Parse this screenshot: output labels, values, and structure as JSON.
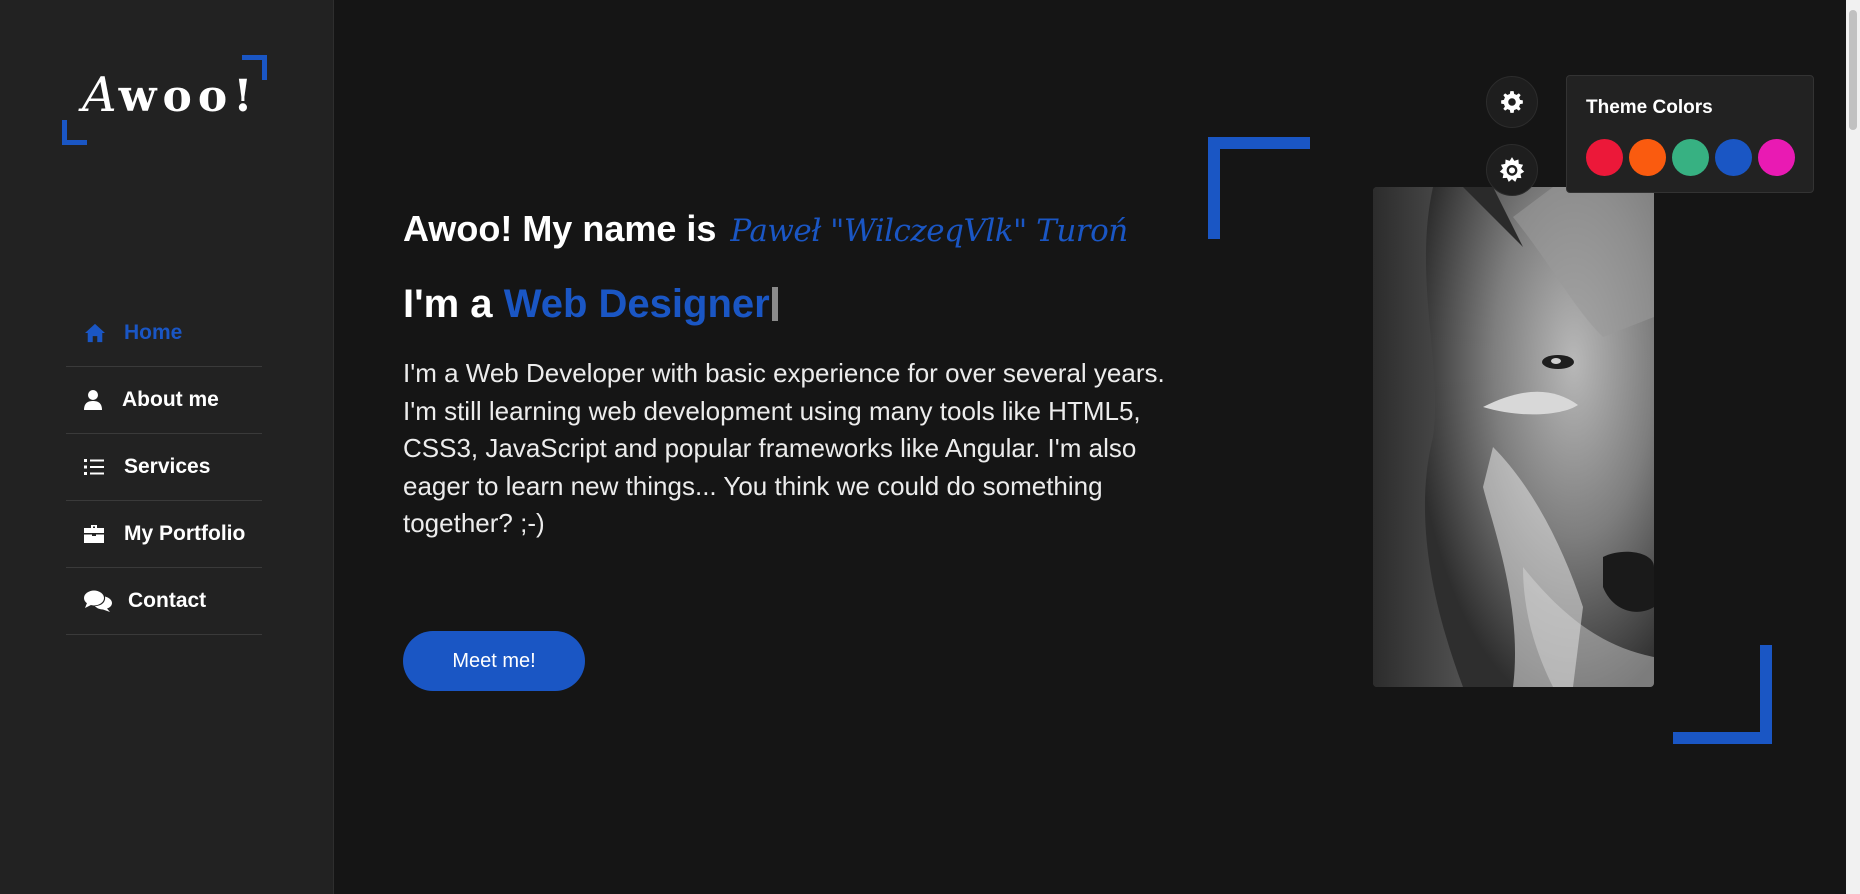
{
  "sidebar": {
    "logo": {
      "first": "A",
      "rest": "woo!"
    },
    "items": [
      {
        "label": "Home",
        "icon": "home-icon",
        "active": true
      },
      {
        "label": "About me",
        "icon": "user-icon",
        "active": false
      },
      {
        "label": "Services",
        "icon": "list-icon",
        "active": false
      },
      {
        "label": "My Portfolio",
        "icon": "briefcase-icon",
        "active": false
      },
      {
        "label": "Contact",
        "icon": "comments-icon",
        "active": false
      }
    ]
  },
  "hero": {
    "greeting": "Awoo! My name is",
    "name": "Paweł \"WilczeqVlk\" Turoń",
    "role_prefix": "I'm a",
    "role": "Web Designer",
    "bio": "I'm a Web Developer with basic experience for over several years. I'm still learning web development using many tools like HTML5, CSS3, JavaScript and popular frameworks like Angular. I'm also eager to learn new things... You think we could do something together? ;-)",
    "cta": "Meet me!"
  },
  "settings": {
    "panel_title": "Theme Colors",
    "icons": [
      "gear-icon",
      "sun-gear-icon"
    ],
    "colors": [
      "#ec1839",
      "#fa5b0f",
      "#37b182",
      "#1a56c4",
      "#e91ab3"
    ]
  },
  "colors": {
    "accent": "#1a56c4",
    "background": "#151515",
    "sidebar": "#222222"
  }
}
